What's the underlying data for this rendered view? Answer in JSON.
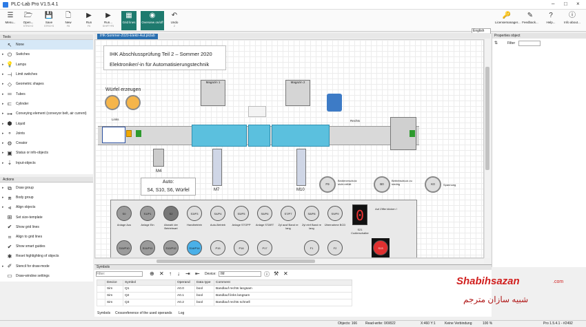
{
  "app": {
    "title": "PLC-Lab Pro V1.5.4.1"
  },
  "ribbon": [
    {
      "label": "Menu...",
      "sub": "",
      "icon": "menu-icon"
    },
    {
      "label": "Open...",
      "sub": "STRG+O",
      "icon": "open-folder-icon"
    },
    {
      "label": "Save",
      "sub": "STRG+S",
      "icon": "save-icon"
    },
    {
      "label": "New",
      "sub": "F8",
      "icon": "new-file-icon"
    },
    {
      "label": "Run",
      "sub": "F5",
      "icon": "run-icon"
    },
    {
      "label": "Run...",
      "sub": "SHIFT+F5",
      "icon": "run-options-icon"
    },
    {
      "label": "Grid lines",
      "sub": "",
      "icon": "grid-icon"
    },
    {
      "label": "Overview on/off",
      "sub": "",
      "icon": "overview-icon"
    },
    {
      "label": "Undo",
      "sub": "Z",
      "icon": "undo-icon"
    }
  ],
  "ribbon_right": [
    {
      "label": "Licensemanager...",
      "icon": "key-icon"
    },
    {
      "label": "Feedback...",
      "icon": "feedback-icon"
    },
    {
      "label": "Help...",
      "icon": "help-icon"
    },
    {
      "label": "Info about...",
      "icon": "info-icon"
    }
  ],
  "language": "English",
  "tools": {
    "title": "Tools",
    "items": [
      "None",
      "Switches",
      "Lamps",
      "Limit switches",
      "Geometric shapes",
      "Tubes",
      "Cylinder",
      "Conveying element (conveyor belt, air current)",
      "Liquid",
      "Joints",
      "Creator",
      "Status or info-objects",
      "Input-objects"
    ]
  },
  "actions": {
    "title": "Actions",
    "items": [
      "Draw group",
      "Body group",
      "Align objects",
      "Set size-template",
      "Show grid lines",
      "Align to grid lines",
      "Show smart guides",
      "Reset highlighting of objects",
      "Stencil for draw-mode",
      "Draw-window settings"
    ]
  },
  "doc_tab": "IHK-Sommer-2020-Elektr-Aut.plclab",
  "canvas": {
    "title1": "IHK Abschlussprüfung Teil 2 – Sommer 2020",
    "title2": "Elektroniker/-in für Automatisierungstechnik",
    "wuerfel": "Würfel erzeugen",
    "magazin1": "Magazin 1",
    "magazin2": "Magazin 2",
    "links": "Links",
    "rechts": "Rechts",
    "m4": "M4",
    "m7": "M7",
    "m10": "M10",
    "auto1": "Auto:",
    "auto2": "S4, S10, S6, Würfel",
    "f9": "F9",
    "f9_cap": "Bedienerschutz nicht erfüllt",
    "b0": "B0",
    "b0_cap": "Betriebsdruck zu niedrig",
    "k0": "K0",
    "k0_cap": "Spannung",
    "seg": "0",
    "s21": "S21",
    "s21_cap": "Codierschalter",
    "ziffer": "Auf Ziffer klicken !",
    "buttons": [
      {
        "id": "S0",
        "cap": "Anlage Aus"
      },
      {
        "id": "S1/P1",
        "cap": "Anlage Ein"
      },
      {
        "id": "S2",
        "cap": "Abwahl der Betriebsart"
      },
      {
        "id": "S3/P3",
        "cap": "Handbetrieb"
      },
      {
        "id": "S4/P4",
        "cap": "Auto-Betrieb"
      },
      {
        "id": "S5/P5",
        "cap": "Anlage STOPP"
      },
      {
        "id": "S6/P6",
        "cap": "Anlage START"
      },
      {
        "id": "S7/P7",
        "cap": "Zyl ausf Band re lang"
      },
      {
        "id": "S8/P8",
        "cap": "Zyl einf Band re lang"
      },
      {
        "id": "S9/P9",
        "cap": "Übernahme BCD"
      }
    ],
    "buttons2": [
      "S10/P10",
      "S11/P11",
      "S12/P12",
      "S14/P14",
      "P15",
      "P16",
      "P17",
      "F1",
      "F2"
    ],
    "s13": "S13"
  },
  "properties": {
    "title": "Properties object",
    "filter": "Filter"
  },
  "symbols": {
    "title": "Symbols",
    "filter_placeholder": "Filter:",
    "device_label": "Device:",
    "device_value": "IM",
    "columns": [
      "",
      "Device",
      "Symbol",
      "Operand",
      "Data type",
      "Comment"
    ],
    "rows": [
      {
        "device": "Sim",
        "symbol": "Q1",
        "operand": "A0.0",
        "type": "bool",
        "comment": "Bandlauf rechts langsam"
      },
      {
        "device": "Sim",
        "symbol": "Q2",
        "operand": "A0.1",
        "type": "bool",
        "comment": "Bandlauf links langsam"
      },
      {
        "device": "Sim",
        "symbol": "Q3",
        "operand": "A0.2",
        "type": "bool",
        "comment": "Bandlauf rechts schnell"
      }
    ],
    "tabs": [
      "Symbols",
      "Crossreference of the used operands",
      "Log"
    ]
  },
  "status": {
    "objects": "Objects: 166",
    "rw": "Read-write: 0/0/822",
    "xy": "X:460  Y:1",
    "conn": "Keine Verbindung",
    "zoom": "100 %",
    "version": "Pro 1.5.4.1 - #2492"
  },
  "watermark": {
    "latin": "Shabihsazan",
    "tld": ".com",
    "arabic": "شبیه سازان مترجم"
  }
}
